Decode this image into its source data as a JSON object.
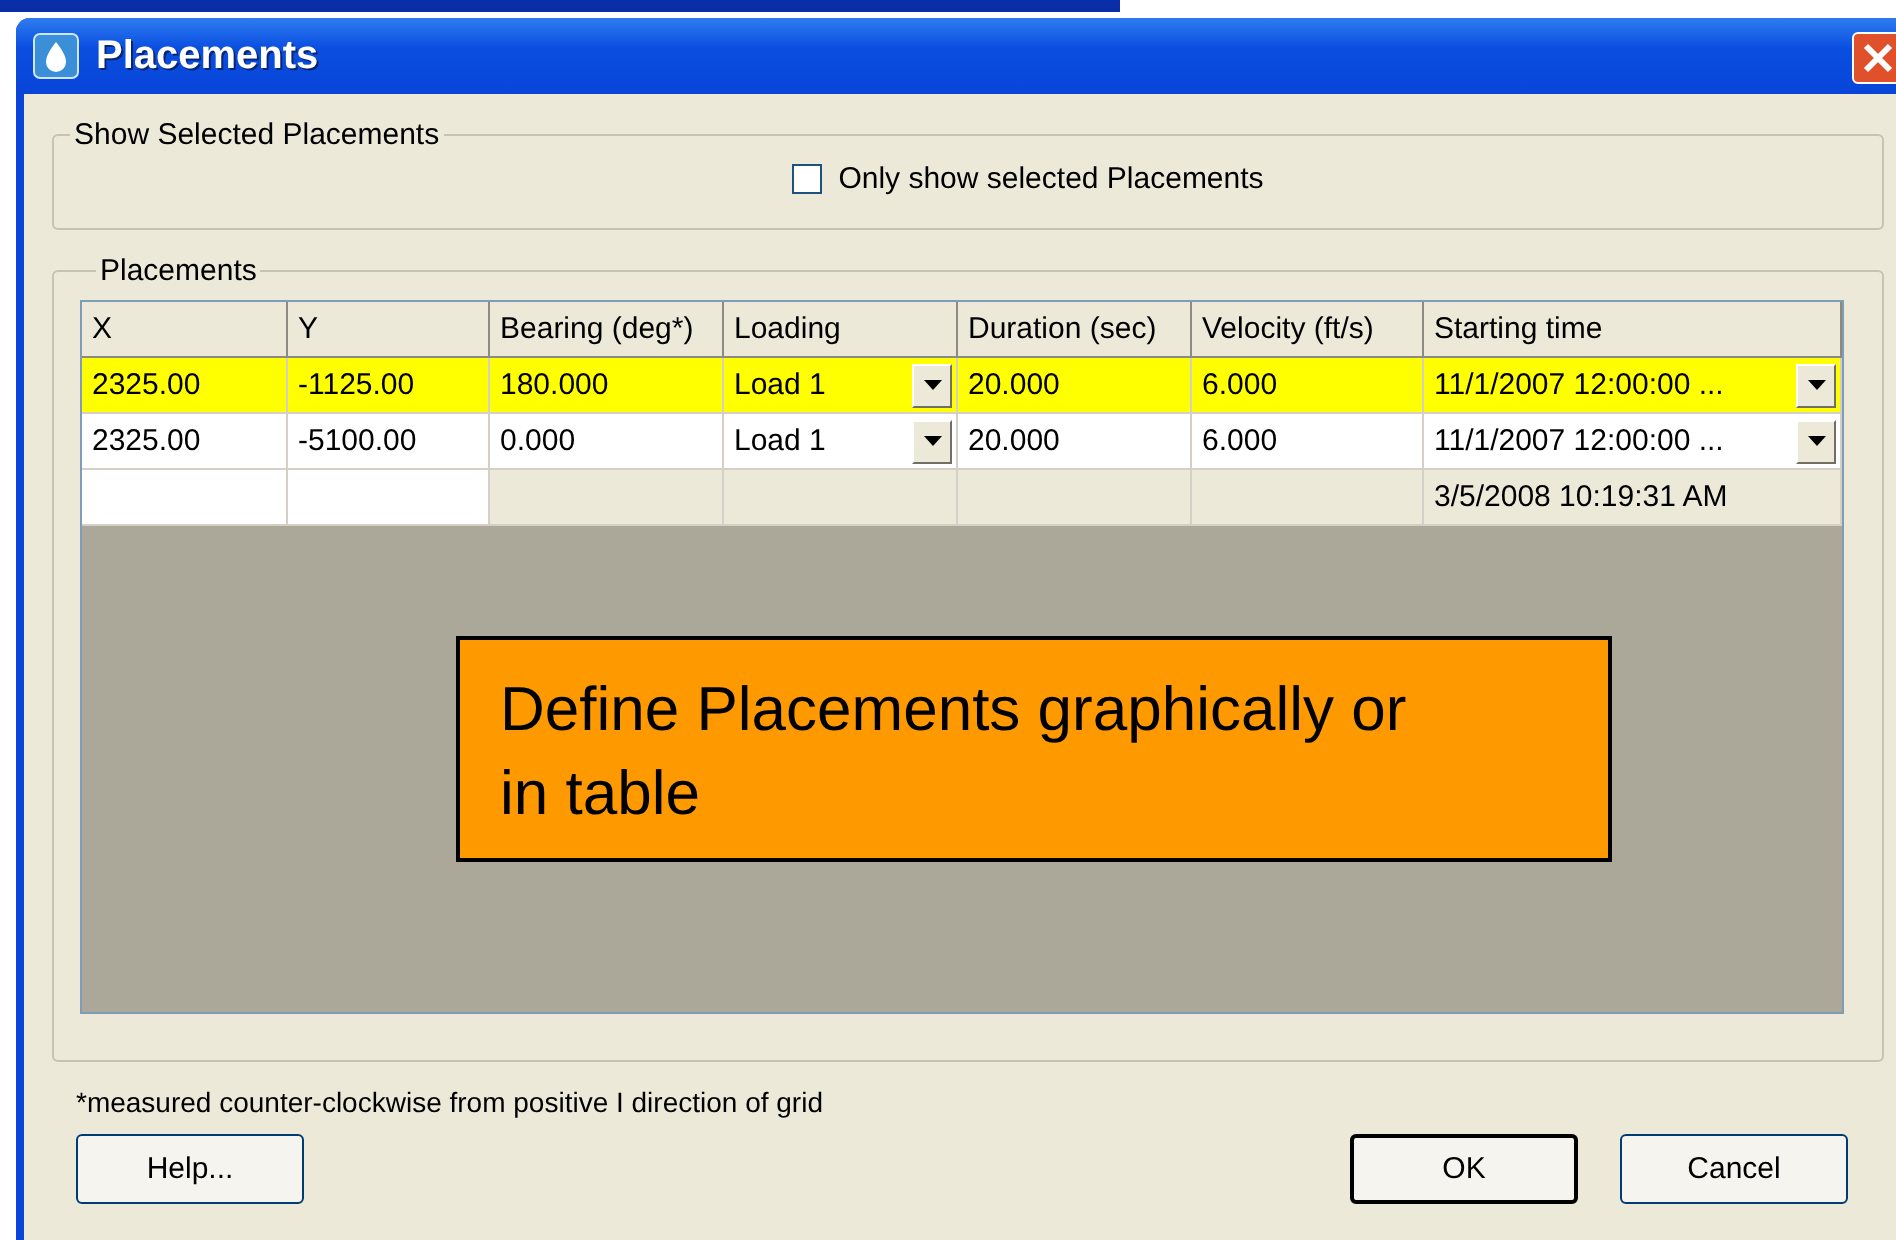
{
  "window": {
    "title": "Placements"
  },
  "selection_group": {
    "title": "Show Selected Placements",
    "checkbox": {
      "label": "Only show selected Placements",
      "checked": false
    }
  },
  "placements_group": {
    "title": "Placements",
    "table": {
      "columns": [
        {
          "label": "X",
          "kind": "text"
        },
        {
          "label": "Y",
          "kind": "text"
        },
        {
          "label": "Bearing (deg*)",
          "kind": "text"
        },
        {
          "label": "Loading",
          "kind": "dropdown"
        },
        {
          "label": "Duration (sec)",
          "kind": "text"
        },
        {
          "label": "Velocity (ft/s)",
          "kind": "text"
        },
        {
          "label": "Starting time",
          "kind": "dropdown"
        }
      ],
      "rows": [
        {
          "kind": "entry",
          "selected": true,
          "cells": [
            "2325.00",
            "-1125.00",
            "180.000",
            "Load 1",
            "20.000",
            "6.000",
            "11/1/2007 12:00:00 ..."
          ]
        },
        {
          "kind": "entry",
          "selected": false,
          "cells": [
            "2325.00",
            "-5100.00",
            "0.000",
            "Load 1",
            "20.000",
            "6.000",
            "11/1/2007 12:00:00 ..."
          ]
        },
        {
          "kind": "new",
          "selected": false,
          "cells": [
            null,
            null,
            null,
            null,
            null,
            null,
            "3/5/2008 10:19:31 AM"
          ]
        }
      ]
    },
    "callout": {
      "text": "Define Placements graphically or in table"
    }
  },
  "footnote": "*measured counter-clockwise from positive I direction of grid",
  "buttons": [
    {
      "label": "Help...",
      "default": false
    },
    {
      "label": "OK",
      "default": true
    },
    {
      "label": "Cancel",
      "default": false
    }
  ]
}
